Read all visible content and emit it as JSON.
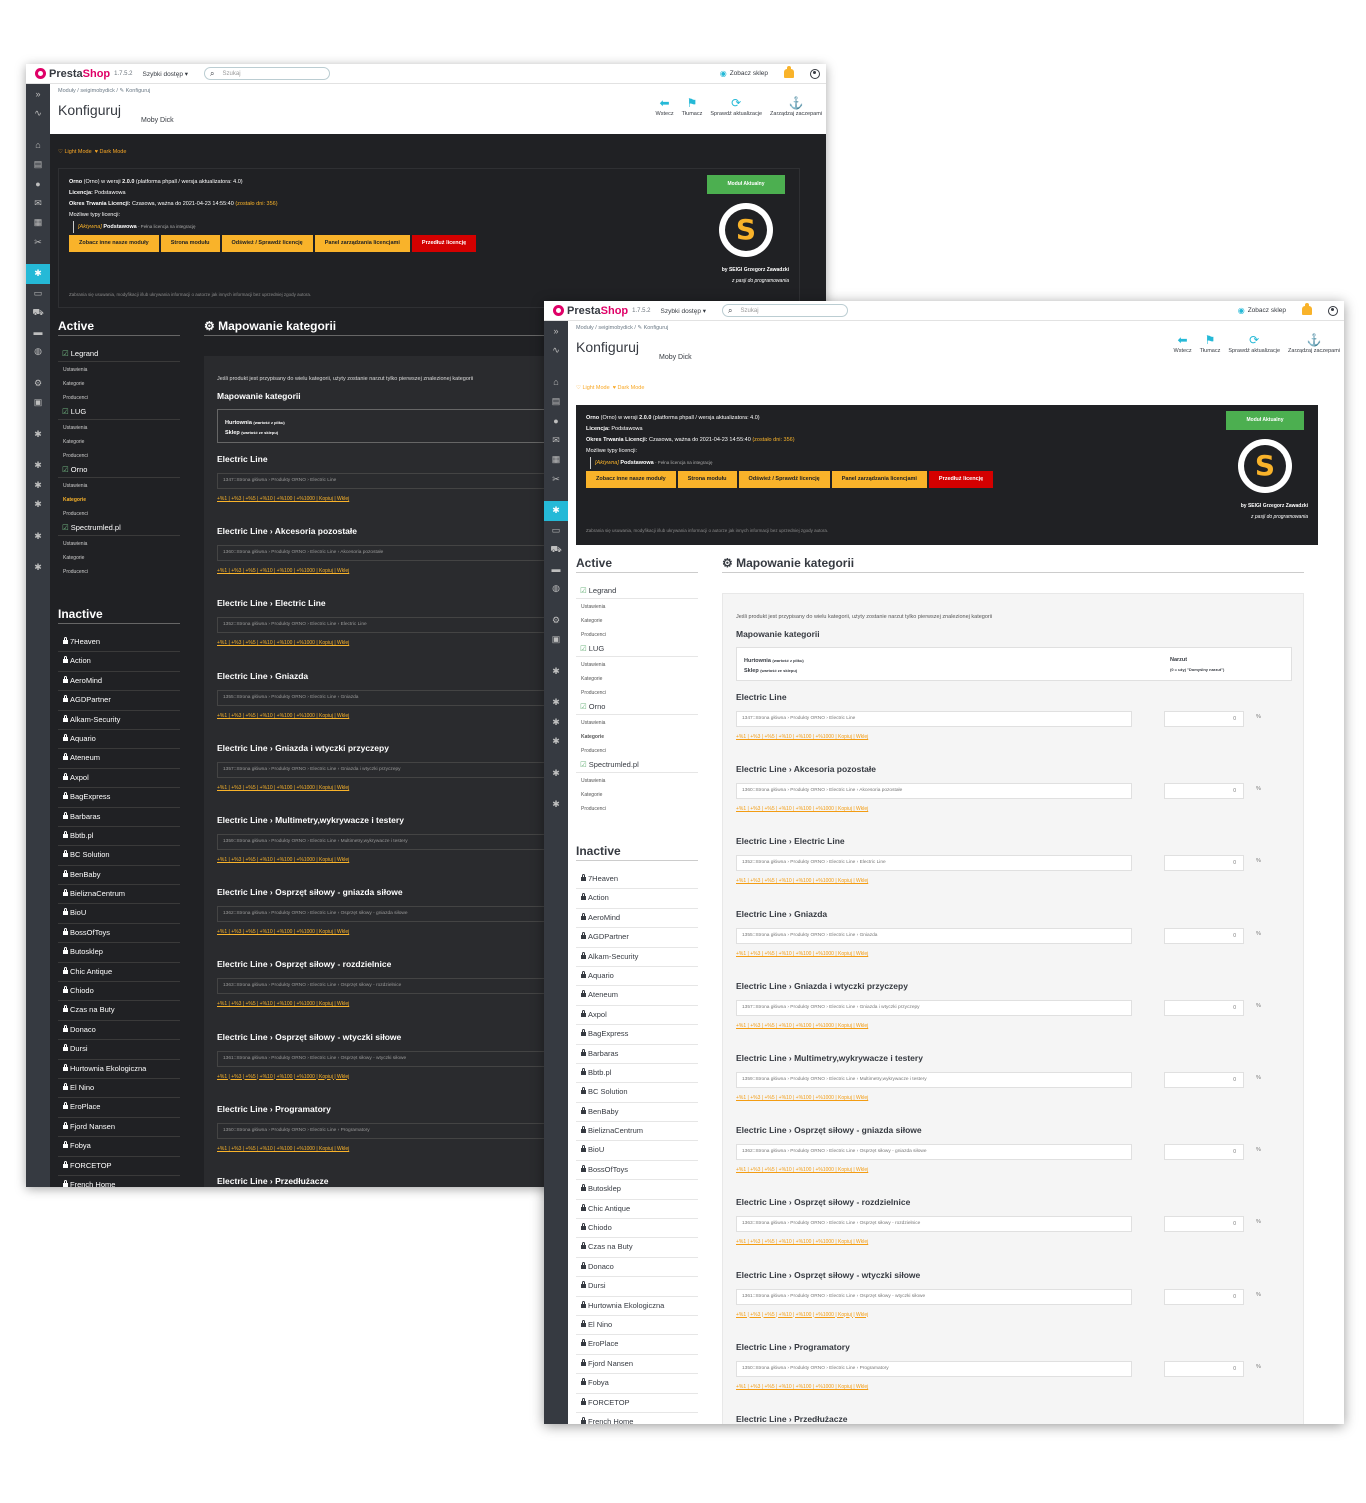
{
  "app": {
    "brand_a": "Presta",
    "brand_b": "Shop",
    "version": "1.7.5.2",
    "quick_access": "Szybki dostęp ▾",
    "search_placeholder": "Szukaj",
    "view_shop": "Zobacz sklep"
  },
  "breadcrumb": {
    "dark": "Moduły  /  seigimobydick  /  ✎ Konfiguruj",
    "light": "Moduły  /  seigimobydick  /  ✎ Konfiguruj"
  },
  "page": {
    "title": "Konfiguruj",
    "subtitle": "Moby Dick"
  },
  "toolbar": [
    {
      "icon": "back-icon",
      "glyph": "⬅",
      "label": "Wstecz"
    },
    {
      "icon": "flag-icon",
      "glyph": "⚑",
      "label": "Tłumacz"
    },
    {
      "icon": "refresh-icon",
      "glyph": "⟳",
      "label": "Sprawdź aktualizacje"
    },
    {
      "icon": "anchor-icon",
      "glyph": "⚓",
      "label": "Zarządzaj zaczepami"
    }
  ],
  "modes": {
    "light": "♡ Light Mode",
    "dark": "♥ Dark Mode"
  },
  "license": {
    "line1_a": "Orno",
    "line1_b": " (Orno) w wersji ",
    "line1_ver": "2.0.0",
    "line1_c": " (platforma phpall / wersja aktualizatora: 4.0)",
    "lic_label": "Licencja:",
    "lic_value": " Podstawowa",
    "period_label": "Okres Trwania Licencji:",
    "period_value": " Czasowa, ważna do 2021-04-23 14:55:40 ",
    "period_left": "(zostało dni: 356)",
    "types_label": "Możliwe typy licencji:",
    "active_tag": "[Aktywna]",
    "active_name": " Podstawowa",
    "active_desc": " - Pełna licencja na integrację",
    "buttons": [
      "Zobacz inne nasze moduły",
      "Strona modułu",
      "Odśwież / Sprawdź licencję",
      "Panel zarządzania licencjami",
      "Przedłuż licencję"
    ],
    "notice": "Zabrania się usuwania, modyfikacji i/lub ukrywania informacji o autorze jak innych informacji bez uprzedniej zgody autora.",
    "update_btn": "Moduł Aktualny",
    "seal_letter": "S",
    "author": "by SEIGI Grzegorz Zawadzki",
    "tagline": "z pasji do programowania"
  },
  "sidebar_left": {
    "active_title": "Active",
    "inactive_title": "Inactive",
    "active": [
      {
        "name": "Legrand",
        "subs": [
          "Ustawienia",
          "Kategorie",
          "Producenci"
        ]
      },
      {
        "name": "LUG",
        "subs": [
          "Ustawienia",
          "Kategorie",
          "Producenci"
        ]
      },
      {
        "name": "Orno",
        "subs": [
          "Ustawienia",
          "Kategorie",
          "Producenci"
        ]
      },
      {
        "name": "Spectrumled.pl",
        "subs": [
          "Ustawienia",
          "Kategorie",
          "Producenci"
        ]
      }
    ],
    "inactive": [
      "7Heaven",
      "Action",
      "AeroMind",
      "AGDPartner",
      "Alkam-Security",
      "Aquario",
      "Ateneum",
      "Axpol",
      "BagExpress",
      "Barbaras",
      "Bbtb.pl",
      "BC Solution",
      "BenBaby",
      "BieliznaCentrum",
      "BioU",
      "BossOfToys",
      "Butosklep",
      "Chic Antique",
      "Chiodo",
      "Czas na Buty",
      "Donaco",
      "Dursi",
      "Hurtownia Ekologiczna",
      "El Nino",
      "EroPlace",
      "Fjord Nansen",
      "Fobya",
      "FORCETOP",
      "French Home"
    ]
  },
  "mapping": {
    "title": "Mapowanie kategorii",
    "info": "Jeśli produkt jest przypisany do wielu kategorii, użyty zostanie narzut tylko pierwszej znalezionej kategorii",
    "subtitle": "Mapowanie kategorii",
    "hdr_wholesale": "Hurtownia",
    "hdr_wholesale_note": "(wartość z pliku)",
    "hdr_shop": "Sklep",
    "hdr_shop_note": "(wartość ze sklepu)",
    "hdr_markup": "Narzut",
    "hdr_markup_note": "(0 = użyj \"Domyślny narzut\")",
    "links": "+%1 | +%3 | +%5 | +%10 | +%100 | +%1000 | Kopiuj | Wklej",
    "markup_value": "0",
    "percent": "%",
    "categories": [
      {
        "name": "Electric Line",
        "path": "1347::Strona główna › Produkty ORNO › Electric Line"
      },
      {
        "name": "Electric Line › Akcesoria pozostałe",
        "path": "1360::Strona główna › Produkty ORNO › Electric Line › Akcesoria pozostałe"
      },
      {
        "name": "Electric Line › Electric Line",
        "path": "1352::Strona główna › Produkty ORNO › Electric Line › Electric Line"
      },
      {
        "name": "Electric Line › Gniazda",
        "path": "1355::Strona główna › Produkty ORNO › Electric Line › Gniazda"
      },
      {
        "name": "Electric Line › Gniazda i wtyczki przyczepy",
        "path": "1357::Strona główna › Produkty ORNO › Electric Line › Gniazda i wtyczki przyczepy"
      },
      {
        "name": "Electric Line › Multimetry,wykrywacze i testery",
        "path": "1359::Strona główna › Produkty ORNO › Electric Line › Multimetry,wykrywacze i testery"
      },
      {
        "name": "Electric Line › Osprzęt siłowy - gniazda siłowe",
        "path": "1362::Strona główna › Produkty ORNO › Electric Line › Osprzęt siłowy - gniazda siłowe"
      },
      {
        "name": "Electric Line › Osprzęt siłowy - rozdzielnice",
        "path": "1363::Strona główna › Produkty ORNO › Electric Line › Osprzęt siłowy - rozdzielnice"
      },
      {
        "name": "Electric Line › Osprzęt siłowy - wtyczki siłowe",
        "path": "1361::Strona główna › Produkty ORNO › Electric Line › Osprzęt siłowy - wtyczki siłowe"
      },
      {
        "name": "Electric Line › Programatory",
        "path": "1350::Strona główna › Produkty ORNO › Electric Line › Programatory"
      },
      {
        "name": "Electric Line › Przedłużacze",
        "path": ""
      }
    ]
  },
  "colors": {
    "accent": "#25b9d7",
    "brand": "#df0067",
    "button": "#f9b32a",
    "danger": "#d40000",
    "success": "#4caf50",
    "dark_bg": "#202124",
    "sidebar": "#363a41"
  }
}
